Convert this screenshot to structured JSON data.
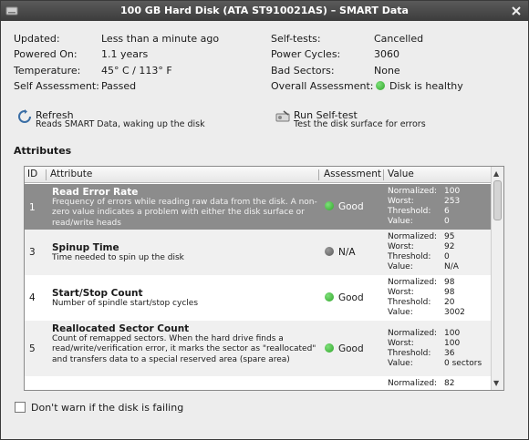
{
  "window": {
    "title": "100 GB Hard Disk (ATA ST910021AS) – SMART Data"
  },
  "info": {
    "updated": {
      "label": "Updated:",
      "value": "Less than a minute ago"
    },
    "powered_on": {
      "label": "Powered On:",
      "value": "1.1 years"
    },
    "temperature": {
      "label": "Temperature:",
      "value": "45° C / 113° F"
    },
    "self_assessment": {
      "label": "Self Assessment:",
      "value": "Passed"
    },
    "self_tests": {
      "label": "Self-tests:",
      "value": "Cancelled"
    },
    "power_cycles": {
      "label": "Power Cycles:",
      "value": "3060"
    },
    "bad_sectors": {
      "label": "Bad Sectors:",
      "value": "None"
    },
    "overall": {
      "label": "Overall Assessment:",
      "value": "Disk is healthy"
    }
  },
  "actions": {
    "refresh": {
      "title": "Refresh",
      "desc": "Reads SMART Data, waking up the disk"
    },
    "selftest": {
      "title": "Run Self-test",
      "desc": "Test the disk surface for errors"
    }
  },
  "section_title": "Attributes",
  "table": {
    "headers": {
      "id": "ID",
      "attribute": "Attribute",
      "assessment": "Assessment",
      "value": "Value"
    },
    "labels": {
      "normalized": "Normalized:",
      "worst": "Worst:",
      "threshold": "Threshold:",
      "value": "Value:"
    },
    "rows": [
      {
        "id": "1",
        "name": "Read Error Rate",
        "desc": "Frequency of errors while reading raw data from the disk. A non-zero value indicates a problem with either the disk surface or read/write heads",
        "assessment": "Good",
        "normalized": "100",
        "worst": "253",
        "threshold": "6",
        "value": "0"
      },
      {
        "id": "3",
        "name": "Spinup Time",
        "desc": "Time needed to spin up the disk",
        "assessment": "N/A",
        "normalized": "95",
        "worst": "92",
        "threshold": "0",
        "value": "N/A"
      },
      {
        "id": "4",
        "name": "Start/Stop Count",
        "desc": "Number of spindle start/stop cycles",
        "assessment": "Good",
        "normalized": "98",
        "worst": "98",
        "threshold": "20",
        "value": "3002"
      },
      {
        "id": "5",
        "name": "Reallocated Sector Count",
        "desc": "Count of remapped sectors. When the hard drive finds a read/write/verification error, it marks the sector as \"reallocated\" and transfers data to a special reserved area (spare area)",
        "assessment": "Good",
        "normalized": "100",
        "worst": "100",
        "threshold": "36",
        "value": "0 sectors"
      },
      {
        "normalized": "82"
      }
    ]
  },
  "checkbox": {
    "label": "Don't warn if the disk is failing"
  },
  "colors": {
    "good": "#2fa52a",
    "na": "#666666",
    "selected_row": "#8c8c8c",
    "titlebar": "#3c3c3c"
  }
}
